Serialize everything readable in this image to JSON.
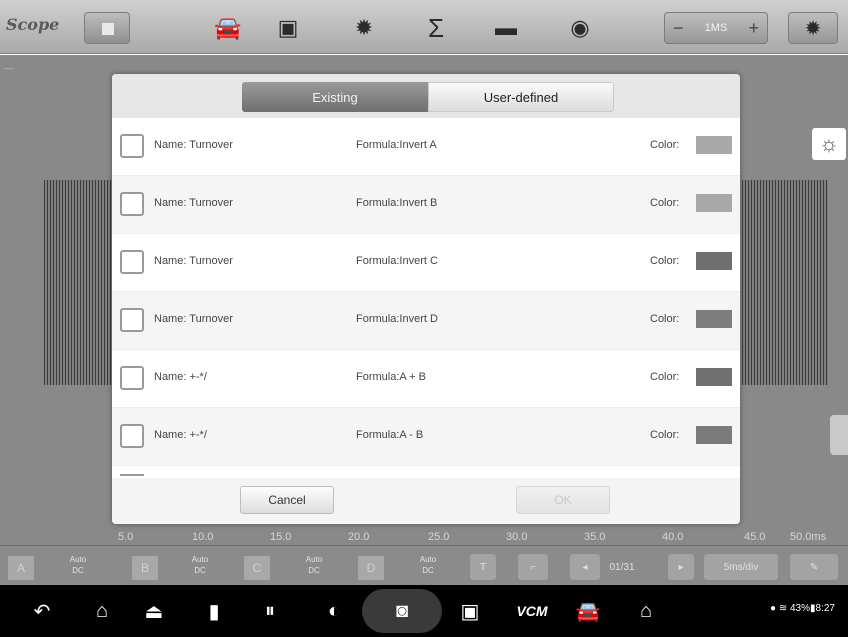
{
  "toolbar": {
    "app_title": "Scope",
    "icons": [
      "car-icon",
      "gallery-icon",
      "gear-icon",
      "sigma-icon",
      "folder-icon",
      "probe-icon"
    ],
    "zoom_value": "1MS",
    "zoom_minus": "−",
    "zoom_plus": "+"
  },
  "scope": {
    "x_ticks": [
      "5.0",
      "10.0",
      "15.0",
      "20.0",
      "25.0",
      "30.0",
      "35.0",
      "40.0",
      "45.0",
      "50.0ms"
    ]
  },
  "channels": [
    {
      "letter": "A",
      "mode1": "Auto",
      "mode2": "DC"
    },
    {
      "letter": "B",
      "mode1": "Auto",
      "mode2": "DC"
    },
    {
      "letter": "C",
      "mode1": "Auto",
      "mode2": "DC"
    },
    {
      "letter": "D",
      "mode1": "Auto",
      "mode2": "DC"
    }
  ],
  "channel_bar": {
    "trigger_label": "T",
    "page_counter": "01/31",
    "timebase": "5ms/div"
  },
  "dialog": {
    "tabs": [
      {
        "label": "Existing",
        "active": true
      },
      {
        "label": "User-defined",
        "active": false
      }
    ],
    "name_prefix": "Name:",
    "color_label": "Color:",
    "rows": [
      {
        "name": "Turnover",
        "formula": "Formula:Invert A",
        "color": "#a9a9a9"
      },
      {
        "name": "Turnover",
        "formula": "Formula:Invert B",
        "color": "#a9a9a9"
      },
      {
        "name": "Turnover",
        "formula": "Formula:Invert C",
        "color": "#6f6f6f"
      },
      {
        "name": "Turnover",
        "formula": "Formula:Invert D",
        "color": "#7d7d7d"
      },
      {
        "name": "+-*/",
        "formula": "Formula:A + B",
        "color": "#707070"
      },
      {
        "name": "+-*/",
        "formula": "Formula:A - B",
        "color": "#7a7a7a"
      }
    ],
    "cancel_label": "Cancel",
    "ok_label": "OK"
  },
  "navbar": {
    "vci_label": "VCM",
    "status_text": "43%▮8:27"
  }
}
